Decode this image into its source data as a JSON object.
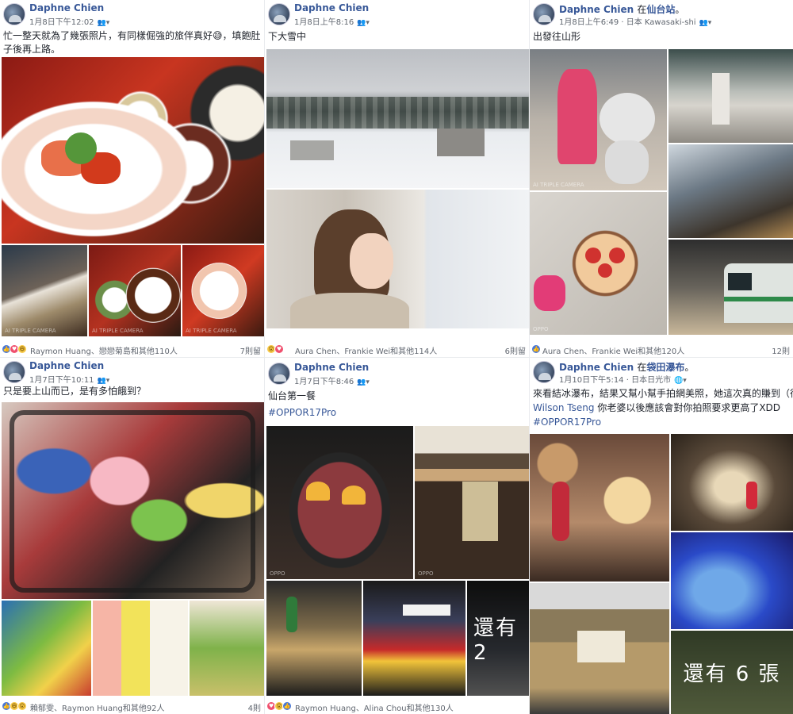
{
  "posts": [
    {
      "author": "Daphne Chien",
      "time": "1月8日下午12:02",
      "loc": "",
      "text": "忙一整天就為了幾張照片，有同樣倔強的旅伴真好😅，填飽肚子後再上路。",
      "reactors": "Raymon Huang、戀戀菊島和其他110人",
      "comments": "7則留"
    },
    {
      "author": "Daphne Chien",
      "time": "1月8日上午8:16",
      "loc": "",
      "text": "下大雪中",
      "reactors": "Aura Chen、Frankie Wei和其他114人",
      "comments": "6則留"
    },
    {
      "author": "Daphne Chien",
      "time": "1月8日上午6:49",
      "loc_pre": "在",
      "loc": "仙台站",
      "loc_suffix": "。",
      "meta_place": "日本 Kawasaki-shi",
      "text": "出發往山形",
      "reactors": "Aura Chen、Frankie Wei和其他120人",
      "comments": "12則"
    },
    {
      "author": "Daphne Chien",
      "time": "1月7日下午10:11",
      "loc": "",
      "text": "只是要上山而已，是有多怕餓到？",
      "reactors": "賴郁雯、Raymon Huang和其他92人",
      "comments": "4則"
    },
    {
      "author": "Daphne Chien",
      "time": "1月7日下午8:46",
      "loc": "",
      "text": "仙台第一餐",
      "hashtag": "#OPPOR17Pro",
      "reactors": "Raymon Huang、Alina Chou和其他130人",
      "more": "還有 2"
    },
    {
      "author": "Daphne Chien",
      "time": "1月10日下午5:14",
      "loc_pre": "在",
      "loc": "袋田瀑布",
      "loc_suffix": "。",
      "meta_place": "日本日光市",
      "text": "來看結冰瀑布，結果又幫小幫手拍網美照，她這次真的賺到（很敢說",
      "mention": "Wilson Tseng",
      "mention_text": "你老婆以後應該會對你拍照要求更高了XDD",
      "hashtag": "#OPPOR17Pro",
      "more": "還有 6 張"
    }
  ],
  "icons": {
    "people": "friends-icon",
    "caret": "caret-down-icon",
    "globe": "globe-icon"
  },
  "watermarks": {
    "oppo": "OPPO",
    "duo": "AI TRIPLE CAMERA",
    "oppo2": "OPPO"
  }
}
